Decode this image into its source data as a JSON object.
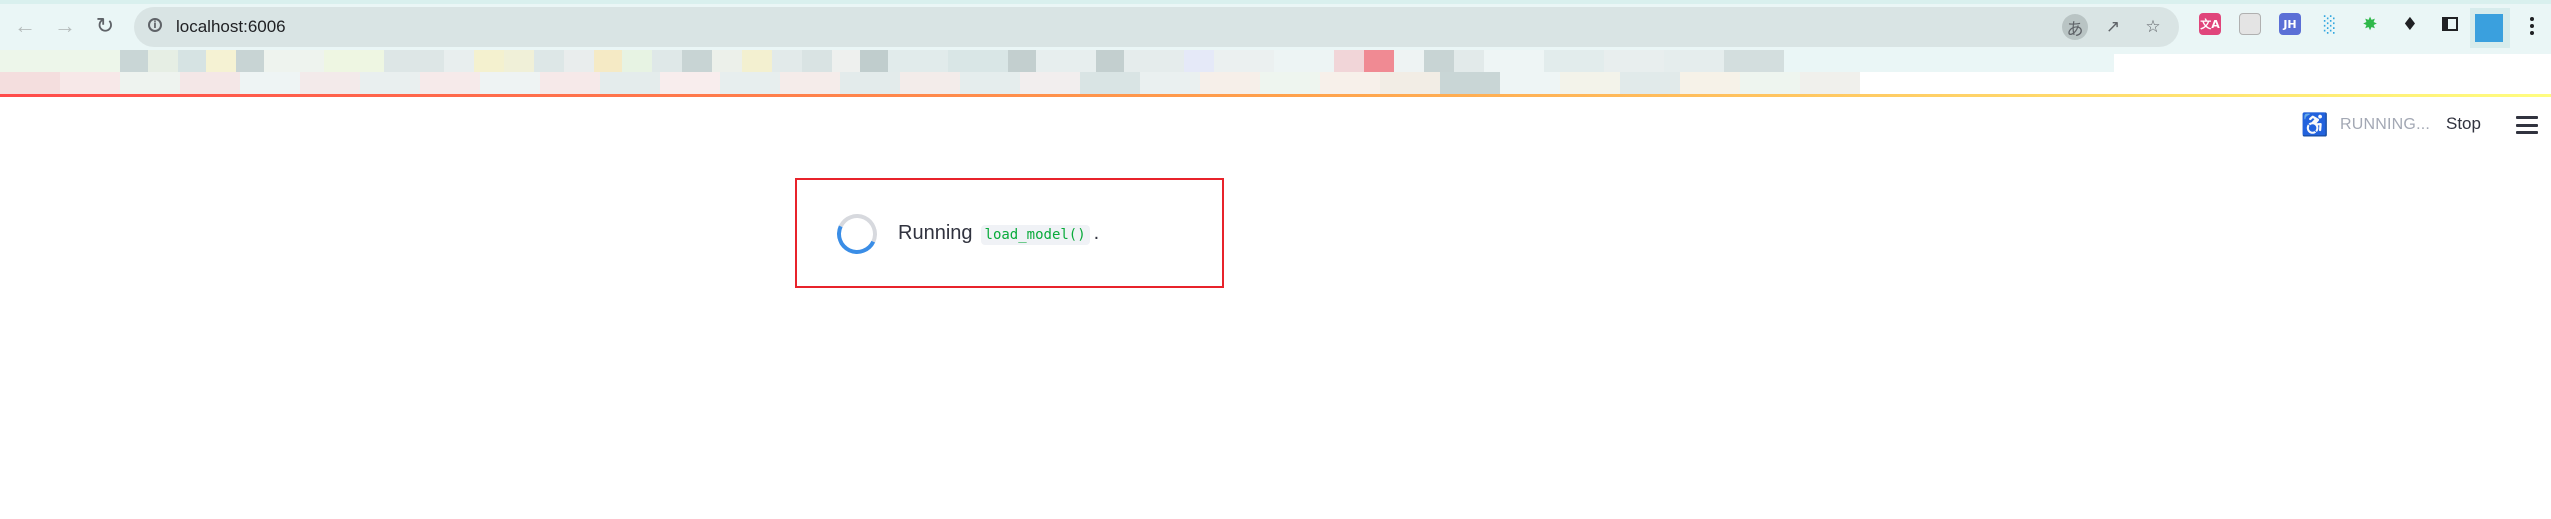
{
  "browser": {
    "url": "localhost:6006",
    "back_icon": "back-arrow-icon",
    "forward_icon": "forward-arrow-icon",
    "reload_icon": "reload-icon",
    "site_info_icon": "info-icon",
    "translate_icon": "translate-icon",
    "share_icon": "share-icon",
    "bookmark_icon": "star-icon",
    "extensions": [
      {
        "name": "ext-translate-icon",
        "text": "文A",
        "color": "#e0457b"
      },
      {
        "name": "ext-document-icon",
        "text": "",
        "color": "#c8c8c8"
      },
      {
        "name": "ext-jh-icon",
        "text": "JH",
        "color": "#5b6fd6"
      },
      {
        "name": "ext-chart-icon",
        "text": "",
        "color": "#33a7e0"
      },
      {
        "name": "ext-green-icon",
        "text": "",
        "color": "#2fb84a"
      },
      {
        "name": "extensions-puzzle-icon",
        "text": "",
        "color": "#202124"
      },
      {
        "name": "sidebar-panel-icon",
        "text": "",
        "color": "#202124"
      }
    ],
    "profile_color": "#3aa0de"
  },
  "header": {
    "status_label": "RUNNING...",
    "stop_label": "Stop",
    "running_icon": "running-man-icon",
    "menu_icon": "hamburger-menu-icon"
  },
  "main": {
    "running_prefix": "Running",
    "function_name": "load_model()",
    "running_suffix": "."
  },
  "colors": {
    "accent_red": "#e8232b",
    "spinner_blue": "#3a8de6",
    "code_green": "#09ab3b"
  }
}
